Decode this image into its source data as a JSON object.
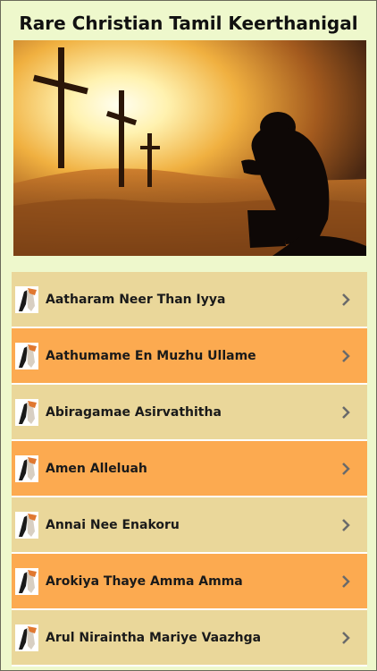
{
  "app": {
    "title": "Rare Christian Tamil Keerthanigal"
  },
  "banner": {
    "image": "sunset-crosses-praying-man"
  },
  "list": {
    "row_icon": "praying-hands-icon",
    "chevron_icon": "chevron-right-icon",
    "items": [
      {
        "label": "Aatharam Neer Than Iyya"
      },
      {
        "label": "Aathumame En Muzhu Ullame"
      },
      {
        "label": "Abiragamae Asirvathitha"
      },
      {
        "label": "Amen Alleluah"
      },
      {
        "label": "Annai Nee Enakoru"
      },
      {
        "label": "Arokiya Thaye Amma Amma"
      },
      {
        "label": "Arul Niraintha Mariye Vaazhga"
      }
    ]
  },
  "colors": {
    "row_light": "#ead79a",
    "row_dark": "#fcaa50",
    "background": "#eef8cc"
  }
}
